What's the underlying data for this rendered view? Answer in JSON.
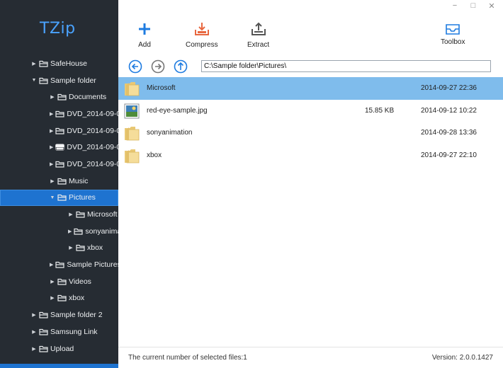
{
  "app": {
    "title": "TZip"
  },
  "window": {
    "minimize": "−",
    "maximize": "□",
    "close": "✕"
  },
  "toolbar": {
    "add_label": "Add",
    "compress_label": "Compress",
    "extract_label": "Extract",
    "toolbox_label": "Toolbox"
  },
  "address": {
    "value": "C:\\Sample folder\\Pictures\\"
  },
  "sidebar": {
    "items": [
      {
        "label": "SafeHouse",
        "level": 0,
        "expanded": false
      },
      {
        "label": "Sample folder",
        "level": 0,
        "expanded": true
      },
      {
        "label": "Documents",
        "level": 1,
        "expanded": false
      },
      {
        "label": "DVD_2014-09-0",
        "level": 1,
        "expanded": false
      },
      {
        "label": "DVD_2014-09-0",
        "level": 1,
        "expanded": false
      },
      {
        "label": "DVD_2014-09-0",
        "level": 1,
        "expanded": false,
        "icon": "drive"
      },
      {
        "label": "DVD_2014-09-0",
        "level": 1,
        "expanded": false
      },
      {
        "label": "Music",
        "level": 1,
        "expanded": false
      },
      {
        "label": "Pictures",
        "level": 1,
        "expanded": true,
        "selected": true
      },
      {
        "label": "Microsoft",
        "level": 2,
        "expanded": false
      },
      {
        "label": "sonyanimation",
        "level": 2,
        "expanded": false
      },
      {
        "label": "xbox",
        "level": 2,
        "expanded": false
      },
      {
        "label": "Sample Pictures",
        "level": 1,
        "expanded": false
      },
      {
        "label": "Videos",
        "level": 1,
        "expanded": false
      },
      {
        "label": "xbox",
        "level": 1,
        "expanded": false
      },
      {
        "label": "Sample folder 2",
        "level": 0,
        "expanded": false
      },
      {
        "label": "Samsung Link",
        "level": 0,
        "expanded": false
      },
      {
        "label": "Upload",
        "level": 0,
        "expanded": false
      }
    ]
  },
  "files": [
    {
      "name": "Microsoft",
      "size": "",
      "date": "2014-09-27 22:36",
      "type": "folder",
      "selected": true
    },
    {
      "name": "red-eye-sample.jpg",
      "size": "15.85 KB",
      "date": "2014-09-12 10:22",
      "type": "image",
      "selected": false
    },
    {
      "name": "sonyanimation",
      "size": "",
      "date": "2014-09-28 13:36",
      "type": "folder",
      "selected": false
    },
    {
      "name": "xbox",
      "size": "",
      "date": "2014-09-27 22:10",
      "type": "folder",
      "selected": false
    }
  ],
  "status": {
    "selected_text": "The current number of selected files:1",
    "version_text": "Version: 2.0.0.1427"
  },
  "colors": {
    "sidebar_bg": "#262c33",
    "accent": "#1e73d0",
    "logo": "#4aa3ff",
    "row_selected": "#7fbcec",
    "compress": "#e8673f"
  },
  "icons": {
    "add": "plus-icon",
    "compress": "compress-icon",
    "extract": "extract-icon",
    "toolbox": "toolbox-icon",
    "back": "back-arrow-icon",
    "forward": "forward-arrow-icon",
    "up": "up-arrow-icon"
  }
}
